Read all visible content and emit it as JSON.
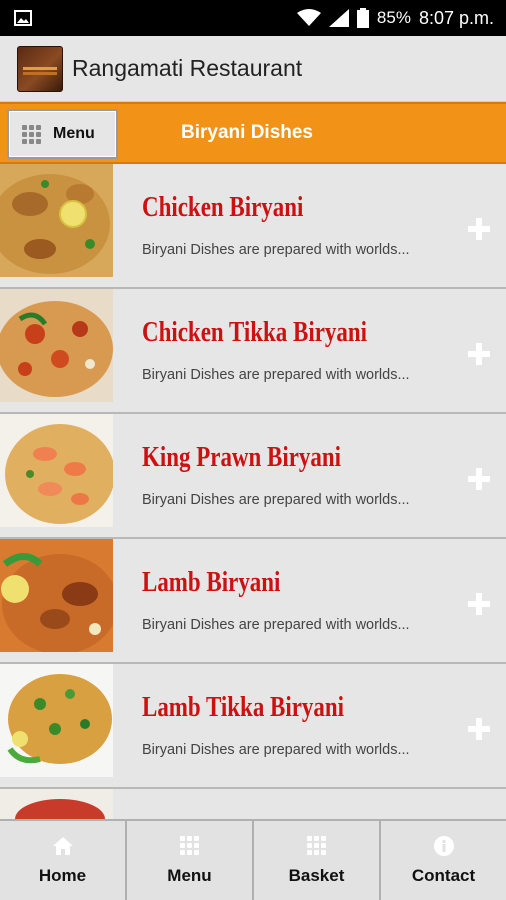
{
  "status_bar": {
    "battery": "85%",
    "time": "8:07 p.m."
  },
  "header": {
    "title": "Rangamati Restaurant"
  },
  "category_bar": {
    "menu_label": "Menu",
    "title": "Biryani Dishes"
  },
  "dishes": [
    {
      "name": "Chicken Biryani",
      "description": "Biryani Dishes are prepared with worlds..."
    },
    {
      "name": "Chicken Tikka Biryani",
      "description": "Biryani Dishes are prepared with worlds..."
    },
    {
      "name": "King Prawn Biryani",
      "description": "Biryani Dishes are prepared with worlds..."
    },
    {
      "name": "Lamb Biryani",
      "description": "Biryani Dishes are prepared with worlds..."
    },
    {
      "name": "Lamb Tikka Biryani",
      "description": "Biryani Dishes are prepared with worlds..."
    }
  ],
  "bottom_nav": {
    "home": "Home",
    "menu": "Menu",
    "basket": "Basket",
    "contact": "Contact"
  },
  "colors": {
    "accent": "#f29318",
    "dish_name": "#cc1111",
    "background": "#e6e6e6"
  }
}
